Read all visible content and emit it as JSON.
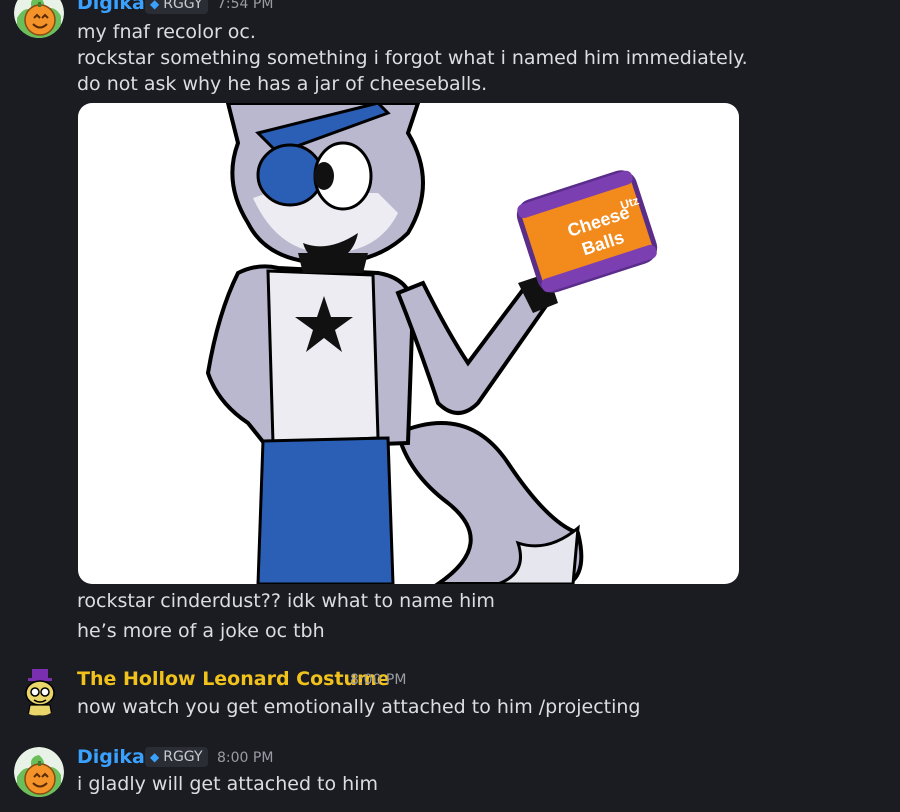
{
  "colors": {
    "background": "#1b1c21",
    "digikat_name": "#3aa1ff",
    "leonard_name": "#f1c21b",
    "badge_bg": "#2b2d35",
    "text": "#dcdde1",
    "timestamp": "#9a9ba3"
  },
  "messages": [
    {
      "author": "Digikat",
      "badge": "RGGY",
      "time": "7:54 PM",
      "avatar_icon": "pumpkin-avatar-icon",
      "lines": [
        "my fnaf recolor oc.",
        "rockstar something something i forgot what i named him immediately.",
        "do not ask why he has a jar of cheeseballs."
      ],
      "attachment": {
        "type": "image",
        "description_icon": "oc-drawing-image",
        "jar_lines": [
          "Utz",
          "Cheese",
          "Balls"
        ]
      },
      "after_lines": [
        "rockstar cinderdust?? idk what to name him",
        "he’s more of a joke oc tbh"
      ]
    },
    {
      "author": "The Hollow Leonard Costume",
      "time": "8:00 PM",
      "avatar_icon": "leonard-avatar-icon",
      "lines": [
        "now watch you get emotionally attached to him /projecting"
      ]
    },
    {
      "author": "Digikat",
      "badge": "RGGY",
      "time": "8:00 PM",
      "avatar_icon": "pumpkin-avatar-icon",
      "lines": [
        "i gladly will get attached to him"
      ]
    }
  ]
}
